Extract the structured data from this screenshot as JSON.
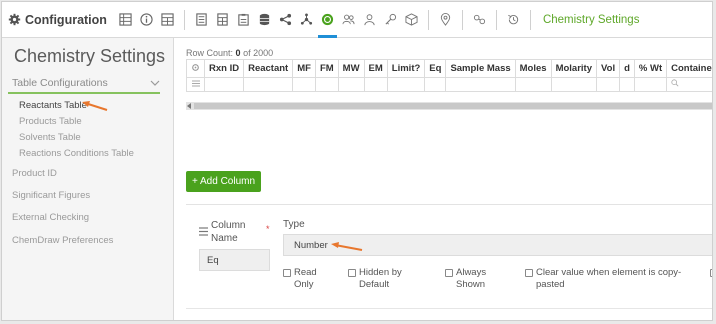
{
  "toolbar": {
    "app_title": "Configuration",
    "icons": [
      "grid-icon",
      "info-icon",
      "table-icon",
      "document-icon",
      "spreadsheet-icon",
      "clipboard-icon",
      "database-icon",
      "share-icon",
      "molecule-icon",
      "chemistry-icon",
      "people-icon",
      "user-icon",
      "key-icon",
      "cube-icon",
      "location-icon",
      "link-icon",
      "history-icon"
    ],
    "active_icon": "chemistry-icon",
    "active_link": "Chemistry Settings",
    "accent_color": "#1f8fd6",
    "link_color": "#5fa82a"
  },
  "sidebar": {
    "title": "Chemistry Settings",
    "group_label": "Table Configurations",
    "sub_items": [
      "Reactants Table",
      "Products Table",
      "Solvents Table",
      "Reactions Conditions Table"
    ],
    "active_sub_item": "Reactants Table",
    "items": [
      "Product ID",
      "Significant Figures",
      "External Checking",
      "ChemDraw Preferences"
    ],
    "accent_color": "#86c25e"
  },
  "grid": {
    "row_count_label": "Row Count:",
    "row_count_value": "0",
    "row_count_suffix": "of 2000",
    "columns": [
      "Rxn ID",
      "Reactant",
      "MF",
      "FM",
      "MW",
      "EM",
      "Limit?",
      "Eq",
      "Sample Mass",
      "Moles",
      "Molarity",
      "Vol",
      "d",
      "% Wt",
      "Containe"
    ]
  },
  "add_column_button": "+ Add Column",
  "column_form": {
    "column_name_label": "Column Name",
    "required_mark": "*",
    "column_name_value": "Eq",
    "type_label": "Type",
    "type_value": "Number",
    "checkboxes": [
      {
        "label": "Read Only",
        "checked": false
      },
      {
        "label": "Hidden by Default",
        "checked": false
      },
      {
        "label": "Always Shown",
        "checked": false
      },
      {
        "label": "Clear value when element is copy-pasted",
        "checked": false
      }
    ]
  },
  "colors": {
    "add_button": "#4aa21d",
    "annotation_arrow": "#e8772e"
  }
}
